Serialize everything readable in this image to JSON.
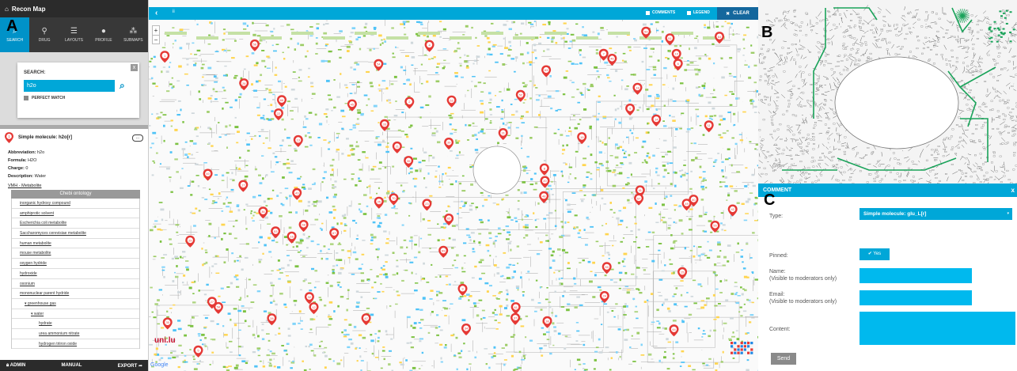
{
  "panel_letters": {
    "a": "A",
    "b": "B",
    "c": "C"
  },
  "app": {
    "title": "Recon Map"
  },
  "nav": {
    "tabs": [
      {
        "label": "SEARCH",
        "icon": "search-icon",
        "active": true
      },
      {
        "label": "DRUG",
        "icon": "pin-icon",
        "active": false
      },
      {
        "label": "LAYOUTS",
        "icon": "list-icon",
        "active": false
      },
      {
        "label": "PROFILE",
        "icon": "user-icon",
        "active": false
      },
      {
        "label": "SUBMAPS",
        "icon": "sitemap-icon",
        "active": false
      }
    ]
  },
  "search": {
    "label": "SEARCH:",
    "value": "h2o",
    "close_label": "x",
    "perfect_match_label": "PERFECT MATCH"
  },
  "element": {
    "marker_number": "1",
    "title": "Simple molecule: h2o[r]",
    "comment_icon_text": "...",
    "abbreviation_label": "Abbreviation:",
    "abbreviation": "h2o",
    "formula_label": "Formula:",
    "formula": "H2O",
    "charge_label": "Charge:",
    "charge": "0",
    "description_label": "Description:",
    "description": "Water",
    "vmh_link": "VMH - Metabolite"
  },
  "ontology": {
    "header": "Chebi ontology",
    "items": [
      {
        "label": "inorganic hydroxy compound",
        "level": 0
      },
      {
        "label": "amphiprotic solvent",
        "level": 0
      },
      {
        "label": "Escherichia coli metabolite",
        "level": 0
      },
      {
        "label": "Saccharomyces cerevisiae metabolite",
        "level": 0
      },
      {
        "label": "human metabolite",
        "level": 0
      },
      {
        "label": "mouse metabolite",
        "level": 0
      },
      {
        "label": "oxygen hydride",
        "level": 0
      },
      {
        "label": "hydroxide",
        "level": 0
      },
      {
        "label": "oxonium",
        "level": 0
      },
      {
        "label": "mononuclear parent hydride",
        "level": 0
      },
      {
        "label": "greenhouse gas",
        "level": 1,
        "expanded": true
      },
      {
        "label": "water",
        "level": 2,
        "expanded": true
      },
      {
        "label": "hydrate",
        "level": 3
      },
      {
        "label": "urea ammonium nitrate",
        "level": 3
      },
      {
        "label": "hydrogen triiron oxide",
        "level": 3
      }
    ]
  },
  "footer": {
    "admin": "ADMIN",
    "manual": "MANUAL",
    "export": "EXPORT"
  },
  "map": {
    "toolbar": {
      "back_icon": "chevron-left-icon",
      "dots": "ii",
      "comments": "COMMENTS",
      "legend": "LEGEND",
      "clear": "CLEAR"
    },
    "zoom": {
      "in": "+",
      "out": "−"
    },
    "logo": "uni.lu",
    "google": "Google",
    "markers": [
      "1",
      "2",
      "3",
      "4",
      "5",
      "6",
      "7",
      "8",
      "9",
      "10",
      "11",
      "12",
      "13",
      "14",
      "15",
      "16",
      "17",
      "18",
      "19",
      "20",
      "21",
      "22",
      "23",
      "24",
      "25",
      "26",
      "27",
      "28",
      "29",
      "30",
      "31",
      "32",
      "33",
      "34",
      "35",
      "36",
      "37",
      "38",
      "39",
      "40",
      "41",
      "42",
      "43",
      "44",
      "45",
      "46",
      "47",
      "48",
      "49",
      "50",
      "51",
      "52",
      "53",
      "54",
      "55",
      "56",
      "57",
      "58",
      "59",
      "60",
      "61",
      "62",
      "63",
      "64",
      "65",
      "66",
      "67",
      "68",
      "69",
      "70"
    ]
  },
  "comment_form": {
    "header": "COMMENT",
    "close": "x",
    "type_label": "Type:",
    "type_value": "Simple molecule: glu_L[r]",
    "pinned_label": "Pinned:",
    "pinned_value": "Yes",
    "name_label": "Name:",
    "name_hint": "(Visible to moderators only)",
    "email_label": "Email:",
    "email_hint": "(Visible to moderators only)",
    "content_label": "Content:",
    "send_label": "Send",
    "name_value": "",
    "email_value": "",
    "content_value": ""
  },
  "colors": {
    "accent": "#00a7d8",
    "accent_dark": "#0092c8",
    "clear_button": "#14679d",
    "header_dark": "#2b2b2b",
    "marker_red": "#e53935",
    "pathway_green": "#1aa35a"
  }
}
